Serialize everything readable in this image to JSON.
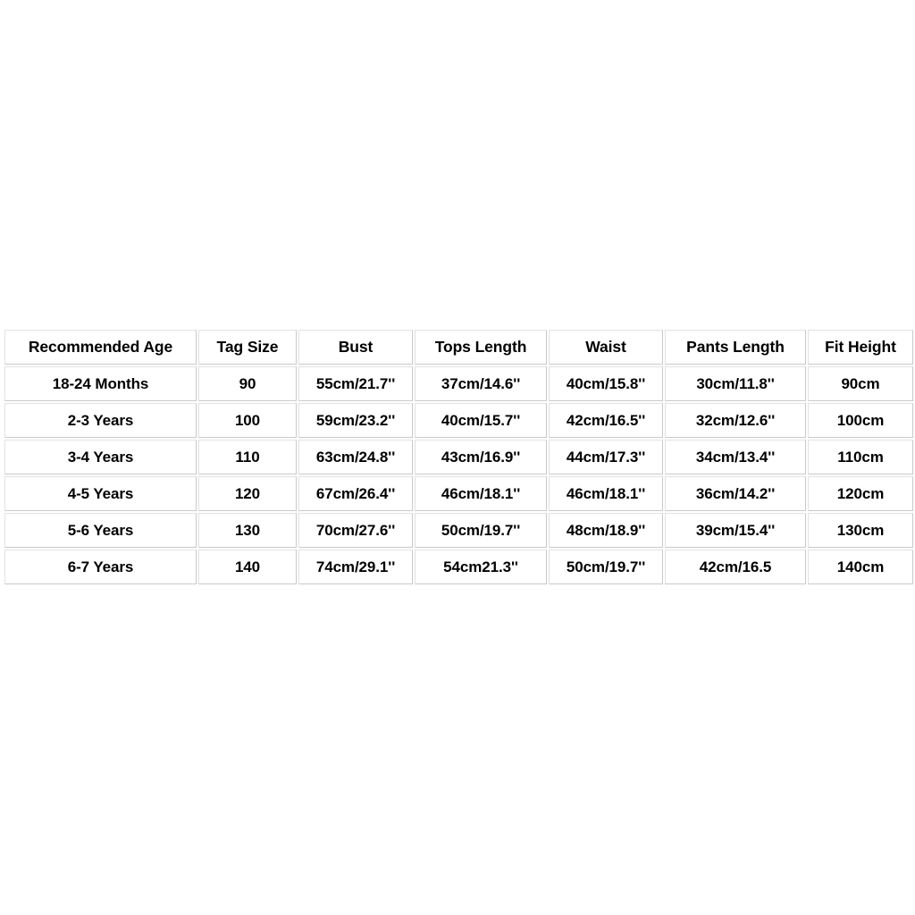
{
  "chart_data": {
    "type": "table",
    "title": "",
    "columns": [
      "Recommended Age",
      "Tag Size",
      "Bust",
      "Tops Length",
      "Waist",
      "Pants Length",
      "Fit Height"
    ],
    "rows": [
      {
        "recommended_age": "18-24 Months",
        "tag_size": "90",
        "bust": "55cm/21.7''",
        "tops_length": "37cm/14.6''",
        "waist": "40cm/15.8''",
        "pants_length": "30cm/11.8''",
        "fit_height": "90cm"
      },
      {
        "recommended_age": "2-3 Years",
        "tag_size": "100",
        "bust": "59cm/23.2''",
        "tops_length": "40cm/15.7''",
        "waist": "42cm/16.5''",
        "pants_length": "32cm/12.6''",
        "fit_height": "100cm"
      },
      {
        "recommended_age": "3-4 Years",
        "tag_size": "110",
        "bust": "63cm/24.8''",
        "tops_length": "43cm/16.9''",
        "waist": "44cm/17.3''",
        "pants_length": "34cm/13.4''",
        "fit_height": "110cm"
      },
      {
        "recommended_age": "4-5 Years",
        "tag_size": "120",
        "bust": "67cm/26.4''",
        "tops_length": "46cm/18.1''",
        "waist": "46cm/18.1''",
        "pants_length": "36cm/14.2''",
        "fit_height": "120cm"
      },
      {
        "recommended_age": "5-6 Years",
        "tag_size": "130",
        "bust": "70cm/27.6''",
        "tops_length": "50cm/19.7''",
        "waist": "48cm/18.9''",
        "pants_length": "39cm/15.4''",
        "fit_height": "130cm"
      },
      {
        "recommended_age": "6-7 Years",
        "tag_size": "140",
        "bust": "74cm/29.1''",
        "tops_length": "54cm21.3''",
        "waist": "50cm/19.7''",
        "pants_length": "42cm/16.5",
        "fit_height": "140cm"
      }
    ]
  },
  "colors": {
    "page_background": "#ffffff",
    "cell_background": "#ffffff",
    "cell_border": "#c9c9c9",
    "text": "#000000"
  }
}
